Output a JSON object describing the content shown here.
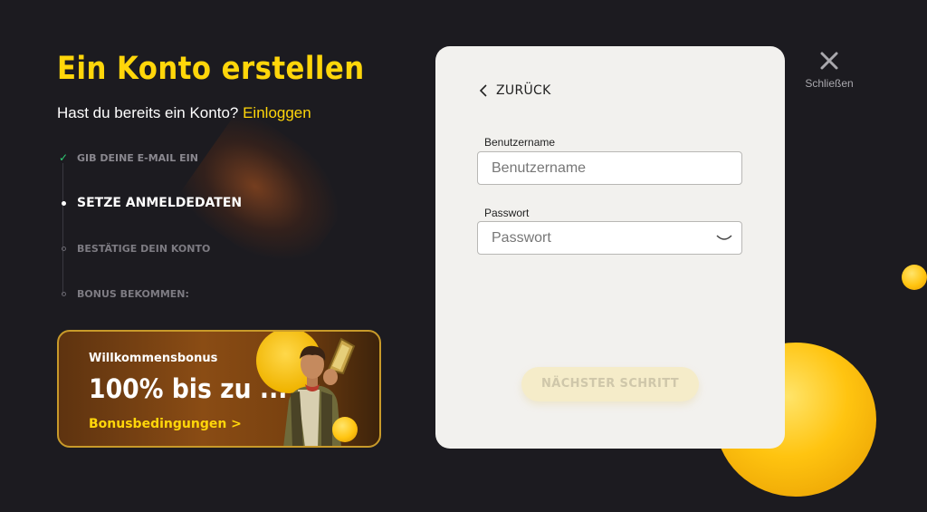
{
  "colors": {
    "accent": "#ffd60a",
    "background": "#1c1b20",
    "panel": "#f2f1ee",
    "check": "#2ecf75"
  },
  "header": {
    "title": "Ein Konto erstellen",
    "subtitle": "Hast du bereits ein Konto?",
    "login_link": "Einloggen"
  },
  "steps": [
    {
      "label": "GIB DEINE E-MAIL EIN",
      "state": "done"
    },
    {
      "label": "SETZE ANMELDEDATEN",
      "state": "active"
    },
    {
      "label": "BESTÄTIGE DEIN KONTO",
      "state": "pending"
    },
    {
      "label": "BONUS BEKOMMEN:",
      "state": "pending"
    }
  ],
  "bonus": {
    "label": "Willkommensbonus",
    "amount": "100% bis zu ...",
    "terms_link": "Bonusbedingungen >"
  },
  "form": {
    "back_label": "ZURÜCK",
    "username_label": "Benutzername",
    "username_placeholder": "Benutzername",
    "password_label": "Passwort",
    "password_placeholder": "Passwort",
    "next_button": "NÄCHSTER SCHRITT"
  },
  "close": {
    "label": "Schließen",
    "icon": "close-icon"
  }
}
